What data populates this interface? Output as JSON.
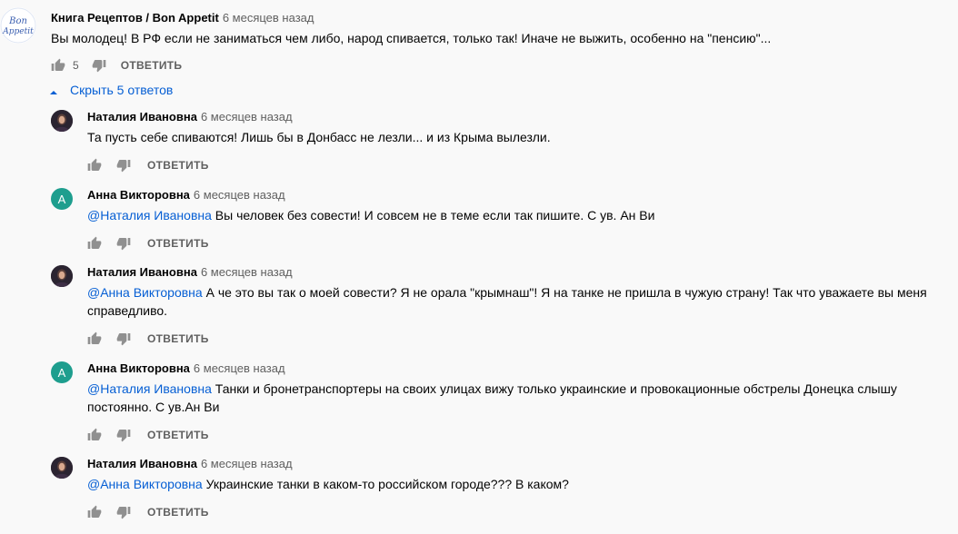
{
  "top_comment": {
    "author": "Книга Рецептов / Bon Appetit",
    "time": "6 месяцев назад",
    "avatar_lines": [
      "Bon",
      "Appetit"
    ],
    "text": "Вы молодец! В РФ если не заниматься чем либо, народ спивается, только так! Иначе не выжить, особенно на \"пенсию\"...",
    "likes": "5",
    "reply_label": "ОТВЕТИТЬ"
  },
  "replies_toggle": {
    "label": "Скрыть 5 ответов",
    "icon": "chevron-up-icon"
  },
  "replies": [
    {
      "author": "Наталия Ивановна",
      "time": "6 месяцев назад",
      "avatar": "photo",
      "mention": "",
      "lines": [
        "Та пусть себе спиваются! Лишь бы в Донбасс не лезли... и из Крыма вылезли."
      ],
      "reply_label": "ОТВЕТИТЬ"
    },
    {
      "author": "Анна Викторовна",
      "time": "6 месяцев назад",
      "avatar": "A",
      "mention": "@Наталия Ивановна",
      "lines": [
        "Вы человек без совести! И совсем не в теме если так пишите. С ув. Ан Ви"
      ],
      "reply_label": "ОТВЕТИТЬ"
    },
    {
      "author": "Наталия Ивановна",
      "time": "6 месяцев назад",
      "avatar": "photo",
      "mention": "@Анна Викторовна",
      "lines": [
        "А че это вы так о моей совести? Я не орала \"крымнаш\"! Я на танке не пришла в чужую страну!  Так что уважаете вы меня",
        "справедливо."
      ],
      "reply_label": "ОТВЕТИТЬ"
    },
    {
      "author": "Анна Викторовна",
      "time": "6 месяцев назад",
      "avatar": "A",
      "mention": "@Наталия Ивановна",
      "lines": [
        "Танки и бронетранспортеры  на своих улицах вижу только украинские и провокационные  обстрелы Донецка слышу",
        "постоянно. С ув.Ан Ви"
      ],
      "reply_label": "ОТВЕТИТЬ"
    },
    {
      "author": "Наталия Ивановна",
      "time": "6 месяцев назад",
      "avatar": "photo",
      "mention": "@Анна Викторовна",
      "lines": [
        "Украинские танки в каком-то российском городе???  В каком?"
      ],
      "reply_label": "ОТВЕТИТЬ"
    }
  ],
  "colors": {
    "link": "#065fd4",
    "secondary": "#606060",
    "avatar_a": "#1e9e8e",
    "background": "#f9f9f9"
  }
}
